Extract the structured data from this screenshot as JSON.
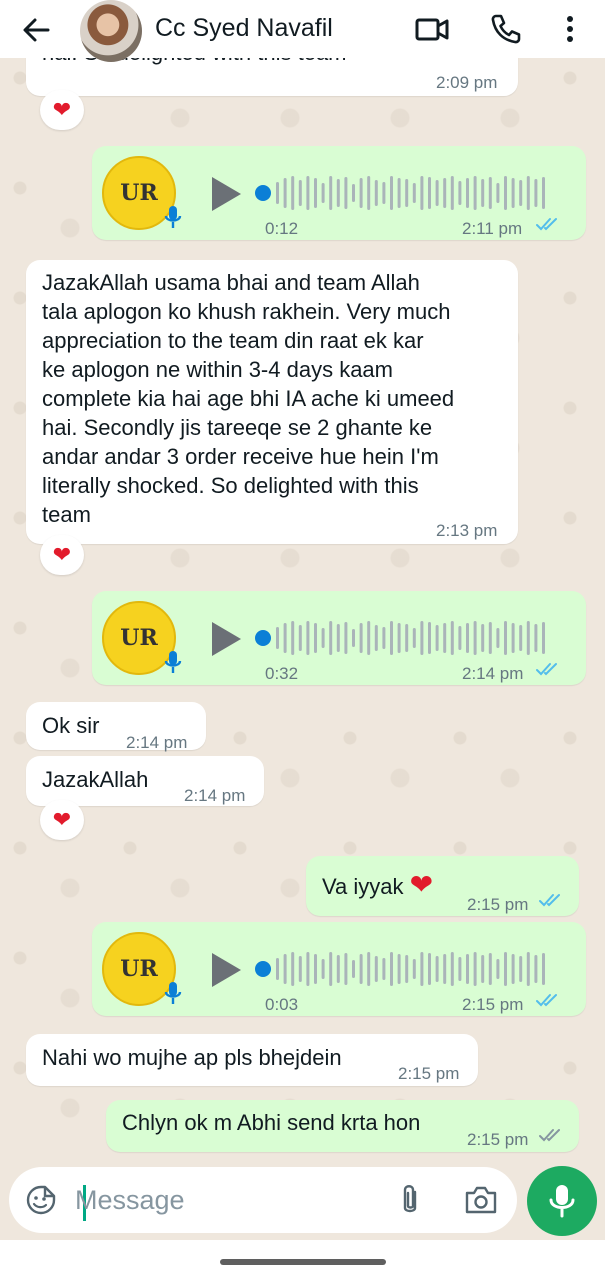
{
  "header": {
    "contact_name": "Cc Syed Navafil",
    "icons": [
      "back-arrow-icon",
      "video-call-icon",
      "voice-call-icon",
      "more-options-icon"
    ]
  },
  "messages": {
    "m0_text": "hai. So delighted with this team",
    "m0_time": "2:09 pm",
    "m0_reaction": "❤",
    "v1_duration": "0:12",
    "v1_time": "2:11 pm",
    "m2_lines": [
      "JazakAllah usama bhai and team Allah",
      "tala aplogon ko khush rakhein. Very much",
      "appreciation to the team din raat ek kar",
      "ke aplogon ne within 3-4 days kaam",
      "complete kia hai age bhi IA ache ki umeed",
      "hai. Secondly jis tareeqe se 2 ghante ke",
      "andar andar 3 order receive hue hein I'm",
      "literally shocked. So delighted with this",
      "team"
    ],
    "m2_time": "2:13 pm",
    "m2_reaction": "❤",
    "v3_duration": "0:32",
    "v3_time": "2:14 pm",
    "m4_text": "Ok sir",
    "m4_time": "2:14 pm",
    "m5_text": "JazakAllah",
    "m5_time": "2:14 pm",
    "m5_reaction": "❤",
    "m6_text": "Va iyyak",
    "m6_emoji": "❤",
    "m6_time": "2:15 pm",
    "v7_duration": "0:03",
    "v7_time": "2:15 pm",
    "m8_text": "Nahi wo mujhe ap pls bhejdein",
    "m8_time": "2:15 pm",
    "m9_text": "Chlyn ok m Abhi send krta hon",
    "m9_time": "2:15 pm"
  },
  "voice_logo_text": "UR",
  "input": {
    "placeholder": "Message"
  },
  "colors": {
    "incoming_bubble": "#ffffff",
    "outgoing_bubble": "#d9fdd3",
    "read_ticks": "#53bdeb",
    "sent_ticks": "#8696a0",
    "accent_green": "#1daa61",
    "voice_progress": "#0b7fd6"
  }
}
